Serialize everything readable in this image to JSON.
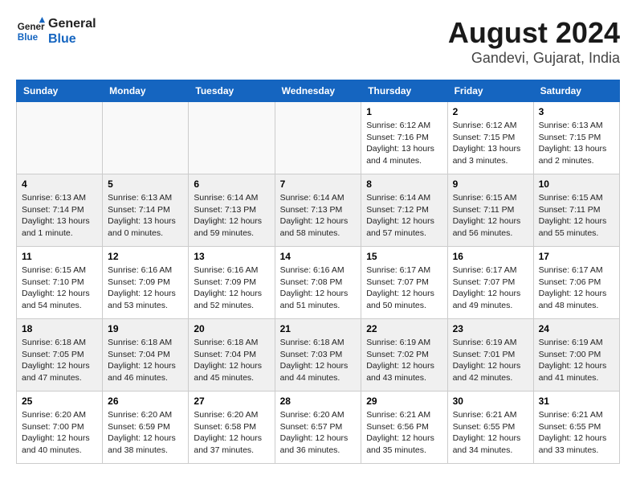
{
  "header": {
    "logo_line1": "General",
    "logo_line2": "Blue",
    "month": "August 2024",
    "location": "Gandevi, Gujarat, India"
  },
  "days_of_week": [
    "Sunday",
    "Monday",
    "Tuesday",
    "Wednesday",
    "Thursday",
    "Friday",
    "Saturday"
  ],
  "weeks": [
    [
      {
        "day": "",
        "info": ""
      },
      {
        "day": "",
        "info": ""
      },
      {
        "day": "",
        "info": ""
      },
      {
        "day": "",
        "info": ""
      },
      {
        "day": "1",
        "info": "Sunrise: 6:12 AM\nSunset: 7:16 PM\nDaylight: 13 hours\nand 4 minutes."
      },
      {
        "day": "2",
        "info": "Sunrise: 6:12 AM\nSunset: 7:15 PM\nDaylight: 13 hours\nand 3 minutes."
      },
      {
        "day": "3",
        "info": "Sunrise: 6:13 AM\nSunset: 7:15 PM\nDaylight: 13 hours\nand 2 minutes."
      }
    ],
    [
      {
        "day": "4",
        "info": "Sunrise: 6:13 AM\nSunset: 7:14 PM\nDaylight: 13 hours\nand 1 minute."
      },
      {
        "day": "5",
        "info": "Sunrise: 6:13 AM\nSunset: 7:14 PM\nDaylight: 13 hours\nand 0 minutes."
      },
      {
        "day": "6",
        "info": "Sunrise: 6:14 AM\nSunset: 7:13 PM\nDaylight: 12 hours\nand 59 minutes."
      },
      {
        "day": "7",
        "info": "Sunrise: 6:14 AM\nSunset: 7:13 PM\nDaylight: 12 hours\nand 58 minutes."
      },
      {
        "day": "8",
        "info": "Sunrise: 6:14 AM\nSunset: 7:12 PM\nDaylight: 12 hours\nand 57 minutes."
      },
      {
        "day": "9",
        "info": "Sunrise: 6:15 AM\nSunset: 7:11 PM\nDaylight: 12 hours\nand 56 minutes."
      },
      {
        "day": "10",
        "info": "Sunrise: 6:15 AM\nSunset: 7:11 PM\nDaylight: 12 hours\nand 55 minutes."
      }
    ],
    [
      {
        "day": "11",
        "info": "Sunrise: 6:15 AM\nSunset: 7:10 PM\nDaylight: 12 hours\nand 54 minutes."
      },
      {
        "day": "12",
        "info": "Sunrise: 6:16 AM\nSunset: 7:09 PM\nDaylight: 12 hours\nand 53 minutes."
      },
      {
        "day": "13",
        "info": "Sunrise: 6:16 AM\nSunset: 7:09 PM\nDaylight: 12 hours\nand 52 minutes."
      },
      {
        "day": "14",
        "info": "Sunrise: 6:16 AM\nSunset: 7:08 PM\nDaylight: 12 hours\nand 51 minutes."
      },
      {
        "day": "15",
        "info": "Sunrise: 6:17 AM\nSunset: 7:07 PM\nDaylight: 12 hours\nand 50 minutes."
      },
      {
        "day": "16",
        "info": "Sunrise: 6:17 AM\nSunset: 7:07 PM\nDaylight: 12 hours\nand 49 minutes."
      },
      {
        "day": "17",
        "info": "Sunrise: 6:17 AM\nSunset: 7:06 PM\nDaylight: 12 hours\nand 48 minutes."
      }
    ],
    [
      {
        "day": "18",
        "info": "Sunrise: 6:18 AM\nSunset: 7:05 PM\nDaylight: 12 hours\nand 47 minutes."
      },
      {
        "day": "19",
        "info": "Sunrise: 6:18 AM\nSunset: 7:04 PM\nDaylight: 12 hours\nand 46 minutes."
      },
      {
        "day": "20",
        "info": "Sunrise: 6:18 AM\nSunset: 7:04 PM\nDaylight: 12 hours\nand 45 minutes."
      },
      {
        "day": "21",
        "info": "Sunrise: 6:18 AM\nSunset: 7:03 PM\nDaylight: 12 hours\nand 44 minutes."
      },
      {
        "day": "22",
        "info": "Sunrise: 6:19 AM\nSunset: 7:02 PM\nDaylight: 12 hours\nand 43 minutes."
      },
      {
        "day": "23",
        "info": "Sunrise: 6:19 AM\nSunset: 7:01 PM\nDaylight: 12 hours\nand 42 minutes."
      },
      {
        "day": "24",
        "info": "Sunrise: 6:19 AM\nSunset: 7:00 PM\nDaylight: 12 hours\nand 41 minutes."
      }
    ],
    [
      {
        "day": "25",
        "info": "Sunrise: 6:20 AM\nSunset: 7:00 PM\nDaylight: 12 hours\nand 40 minutes."
      },
      {
        "day": "26",
        "info": "Sunrise: 6:20 AM\nSunset: 6:59 PM\nDaylight: 12 hours\nand 38 minutes."
      },
      {
        "day": "27",
        "info": "Sunrise: 6:20 AM\nSunset: 6:58 PM\nDaylight: 12 hours\nand 37 minutes."
      },
      {
        "day": "28",
        "info": "Sunrise: 6:20 AM\nSunset: 6:57 PM\nDaylight: 12 hours\nand 36 minutes."
      },
      {
        "day": "29",
        "info": "Sunrise: 6:21 AM\nSunset: 6:56 PM\nDaylight: 12 hours\nand 35 minutes."
      },
      {
        "day": "30",
        "info": "Sunrise: 6:21 AM\nSunset: 6:55 PM\nDaylight: 12 hours\nand 34 minutes."
      },
      {
        "day": "31",
        "info": "Sunrise: 6:21 AM\nSunset: 6:55 PM\nDaylight: 12 hours\nand 33 minutes."
      }
    ]
  ]
}
